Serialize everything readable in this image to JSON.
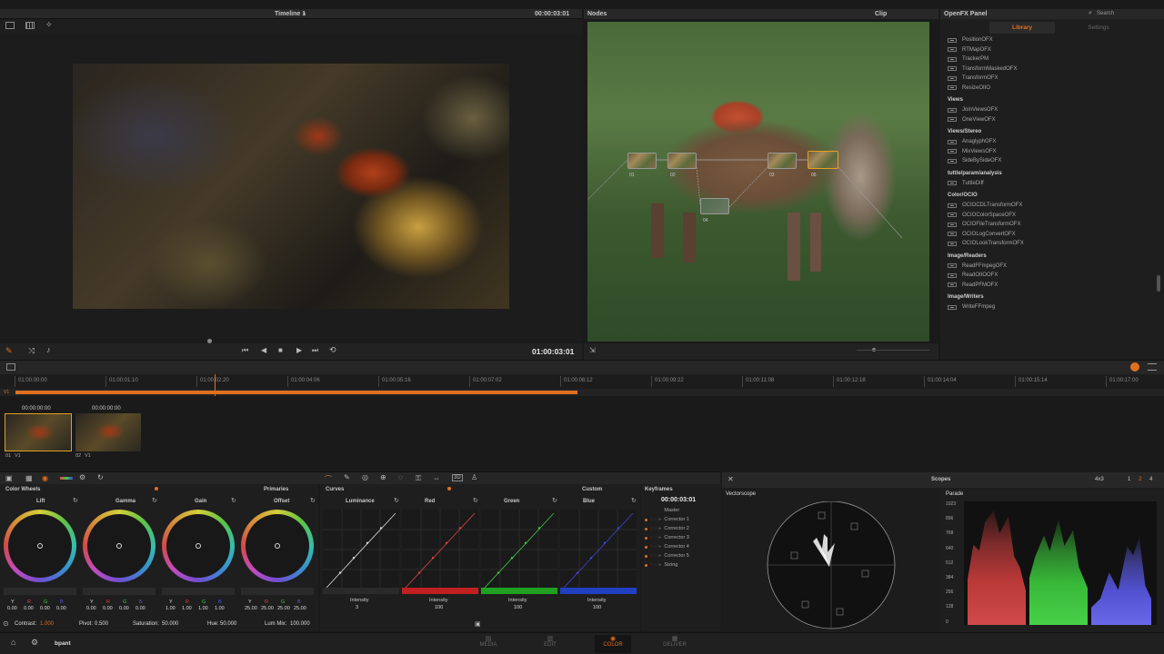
{
  "viewer": {
    "timeline_label": "Timeline 1",
    "timecode_top": "00:00:03:01",
    "timecode": "01:00:03:01"
  },
  "nodes": {
    "title": "Nodes",
    "clip_label": "Clip",
    "labels": [
      "01",
      "02",
      "03",
      "04",
      "06"
    ]
  },
  "ofx": {
    "title": "OpenFX Panel",
    "search": "Search",
    "tab_library": "Library",
    "tab_settings": "Settings",
    "groups": [
      {
        "name": "",
        "items": [
          "PositionOFX",
          "RTMapOFX",
          "TrackerPM",
          "TransformMaskedOFX",
          "TransformOFX",
          "ResizeOIIO"
        ]
      },
      {
        "name": "Views",
        "items": [
          "JoinViewsOFX",
          "OneViewOFX"
        ]
      },
      {
        "name": "Views/Stereo",
        "items": [
          "AnaglyphOFX",
          "MixViewsOFX",
          "SideBySideOFX"
        ]
      },
      {
        "name": "tuttle/param/analysis",
        "items": [
          "TuttleDiff"
        ]
      },
      {
        "name": "Color/OCIO",
        "items": [
          "OCIOCDLTransformOFX",
          "OCIOColorSpaceOFX",
          "OCIOFileTransformOFX",
          "OCIOLogConvertOFX",
          "OCIOLookTransformOFX"
        ]
      },
      {
        "name": "Image/Readers",
        "items": [
          "ReadFFmpegOFX",
          "ReadOIIOOFX",
          "ReadPFMOFX"
        ]
      },
      {
        "name": "Image/Writers",
        "items": [
          "WriteFFmpeg"
        ]
      }
    ]
  },
  "timeline": {
    "ticks": [
      "01:00:00:00",
      "01:00:01:10",
      "01:00:02:20",
      "01:00:04:06",
      "01:00:05:16",
      "01:00:07:02",
      "01:00:08:12",
      "01:00:09:22",
      "01:00:11:08",
      "01:00:12:18",
      "01:00:14:04",
      "01:00:15:14",
      "01:00:17:00"
    ],
    "track_label": "V1",
    "playhead_fraction": 0.23
  },
  "clips": [
    {
      "tc": "00:00:00:00",
      "label": "01",
      "track": "V1"
    },
    {
      "tc": "00:00:00:00",
      "label": "02",
      "track": "V1"
    }
  ],
  "wheels": {
    "title": "Color Wheels",
    "mode": "Primaries",
    "items": [
      {
        "name": "Lift",
        "y": "0.00",
        "r": "0.00",
        "g": "0.00",
        "b": "0.00"
      },
      {
        "name": "Gamma",
        "y": "0.00",
        "r": "0.00",
        "g": "0.00",
        "b": "0.00"
      },
      {
        "name": "Gain",
        "y": "1.00",
        "r": "1.00",
        "g": "1.00",
        "b": "1.00"
      },
      {
        "name": "Offset",
        "y": "25.00",
        "r": "25.00",
        "g": "25.00",
        "b": "25.00"
      }
    ],
    "chan": {
      "y": "Y",
      "r": "R",
      "g": "G",
      "b": "B"
    },
    "contrast_label": "Contrast:",
    "contrast": "1.000",
    "pivot_label": "Pivot:",
    "pivot": "0.500",
    "saturation_label": "Saturation:",
    "saturation": "50.000",
    "hue_label": "Hue:",
    "hue": "50.000",
    "lummix_label": "Lum Mix:",
    "lummix": "100.000"
  },
  "curves": {
    "title": "Curves",
    "mode": "Custom",
    "items": [
      {
        "name": "Luminance",
        "value": "3"
      },
      {
        "name": "Red",
        "value": "100"
      },
      {
        "name": "Green",
        "value": "100"
      },
      {
        "name": "Blue",
        "value": "100"
      }
    ],
    "intensity_label": "Intensity"
  },
  "keyframes": {
    "title": "Keyframes",
    "tc": "00:00:03:01",
    "rows": [
      "Master",
      "Corrector 1",
      "Corrector 2",
      "Corrector 3",
      "Corrector 4",
      "Corrector 5",
      "Sizing"
    ]
  },
  "scopes": {
    "title": "Scopes",
    "layout": "4x3",
    "pages": [
      "1",
      "2",
      "4"
    ],
    "vectorscope": "Vectorscope",
    "parade": "Parade",
    "parade_scale": [
      "1023",
      "896",
      "768",
      "640",
      "512",
      "384",
      "256",
      "128",
      "0"
    ]
  },
  "bottom": {
    "project": "bpant",
    "tabs": [
      "MEDIA",
      "EDIT",
      "COLOR",
      "DELIVER"
    ]
  }
}
